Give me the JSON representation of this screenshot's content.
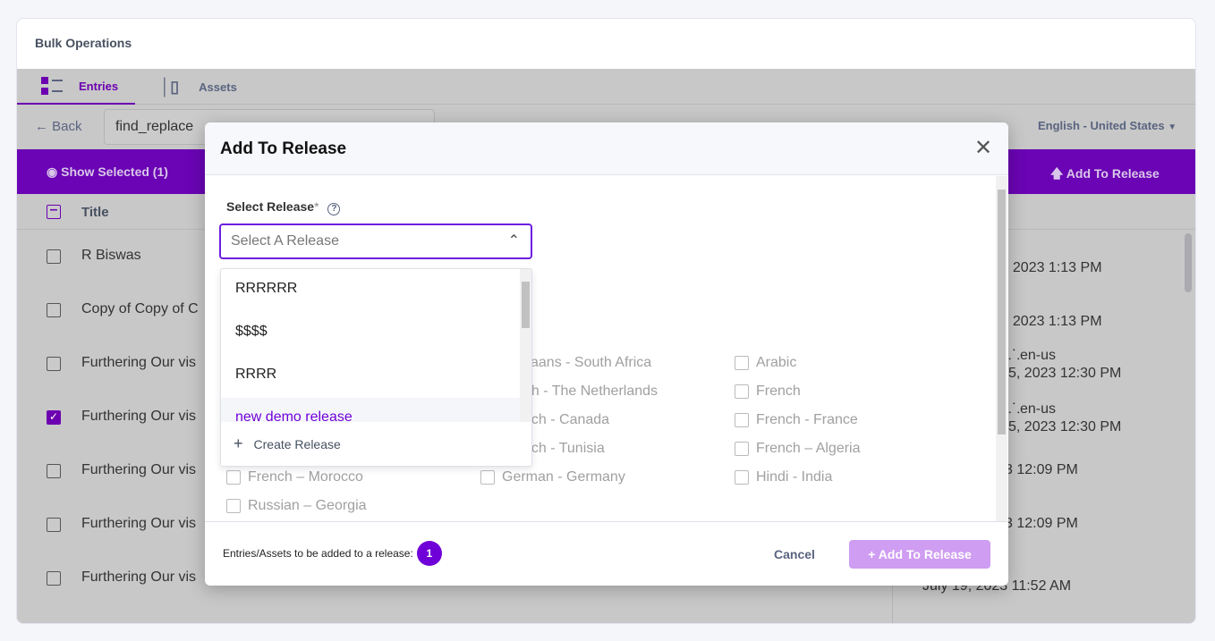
{
  "page": {
    "title": "Bulk Operations"
  },
  "tabs": [
    {
      "label": "Entries",
      "icon": "entries-icon",
      "active": true
    },
    {
      "label": "Assets",
      "icon": "assets-icon",
      "active": false
    }
  ],
  "toolbar": {
    "back_label": "Back",
    "search_value": "find_replace",
    "locale": "English - United States"
  },
  "action_bar": {
    "show_selected": "Show Selected (1)",
    "add_to_release": "Add To Release"
  },
  "table": {
    "title_header": "Title",
    "rows": [
      {
        "title": "R Biswas",
        "checked": false,
        "line1": "",
        "line2": ", 2023 1:13 PM"
      },
      {
        "title": "Copy of Copy of C",
        "checked": false,
        "line1": "",
        "line2": ", 2023 1:13 PM"
      },
      {
        "title": "Furthering Our vis",
        "checked": false,
        "line1": "t  ⸫en-us",
        "line2": "5, 2023 12:30 PM"
      },
      {
        "title": "Furthering Our vis",
        "checked": true,
        "line1": "t  ⸫en-us",
        "line2": "5, 2023 12:30 PM"
      },
      {
        "title": "Furthering Our vis",
        "checked": false,
        "line1": "",
        "line2": "3 12:09 PM"
      },
      {
        "title": "Furthering Our vis",
        "checked": false,
        "line1": "",
        "line2": "3 12:09 PM"
      },
      {
        "title": "Furthering Our vis",
        "checked": false,
        "line1": "",
        "line2": "July 19, 2023 11:52 AM"
      }
    ]
  },
  "modal": {
    "title": "Add To Release",
    "select_label": "Select Release",
    "required_mark": "*",
    "select_placeholder": "Select A Release",
    "options": [
      "RRRRRR",
      "$$$$",
      "RRRR",
      "new demo release"
    ],
    "create_release": "Create Release",
    "languages": [
      {
        "label": "",
        "col": 0
      },
      {
        "label": "Afrikaans - South Africa",
        "col": 1
      },
      {
        "label": "Arabic",
        "col": 2
      },
      {
        "label": "",
        "col": 0
      },
      {
        "label": "Dutch - The Netherlands",
        "col": 1
      },
      {
        "label": "French",
        "col": 2
      },
      {
        "label": "",
        "col": 0
      },
      {
        "label": "French - Canada",
        "col": 1
      },
      {
        "label": "French - France",
        "col": 2
      },
      {
        "label": "",
        "col": 0
      },
      {
        "label": "French - Tunisia",
        "col": 1
      },
      {
        "label": "French – Algeria",
        "col": 2
      },
      {
        "label": "French – Morocco",
        "col": 0
      },
      {
        "label": "German - Germany",
        "col": 1
      },
      {
        "label": "Hindi - India",
        "col": 2
      },
      {
        "label": "Russian – Georgia",
        "col": 0
      }
    ],
    "footer_text": "Entries/Assets to be added to a release:",
    "count": "1",
    "cancel": "Cancel",
    "submit": "Add To Release"
  },
  "colors": {
    "accent": "#6c00b0",
    "selectBorder": "#6c1ee0",
    "submitDisabled": "#cf9df2"
  }
}
